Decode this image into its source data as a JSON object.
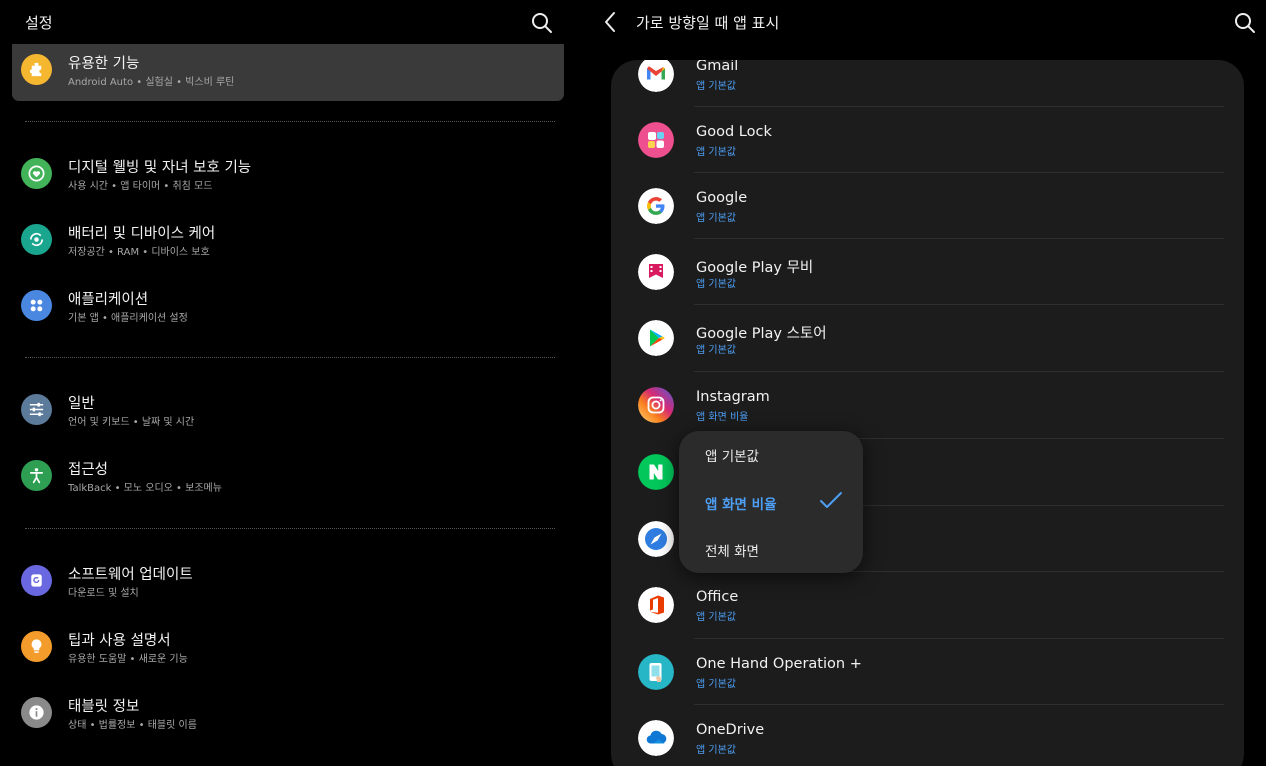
{
  "left": {
    "title": "설정",
    "items": [
      {
        "title": "유용한 기능",
        "sub": "Android Auto  •  실험실  •  빅스비 루틴",
        "icon": "puzzle-icon",
        "color": "#f5b630"
      },
      {
        "title": "디지털 웰빙 및 자녀 보호 기능",
        "sub": "사용 시간  •  앱 타이머  •  취침 모드",
        "icon": "heart-circle-icon",
        "color": "#43b35a"
      },
      {
        "title": "배터리 및 디바이스 케어",
        "sub": "저장공간  •  RAM  •  디바이스 보호",
        "icon": "device-care-icon",
        "color": "#1aa58f"
      },
      {
        "title": "애플리케이션",
        "sub": "기본 앱  •  애플리케이션 설정",
        "icon": "apps-grid-icon",
        "color": "#4a87e0"
      },
      {
        "title": "일반",
        "sub": "언어 및 키보드  •  날짜 및 시간",
        "icon": "sliders-icon",
        "color": "#5c7a9a"
      },
      {
        "title": "접근성",
        "sub": "TalkBack  •  모노 오디오  •  보조메뉴",
        "icon": "accessibility-icon",
        "color": "#2e9e52"
      },
      {
        "title": "소프트웨어 업데이트",
        "sub": "다운로드 및 설치",
        "icon": "update-icon",
        "color": "#6a68e0"
      },
      {
        "title": "팁과 사용 설명서",
        "sub": "유용한 도움말  •  새로운 기능",
        "icon": "lightbulb-icon",
        "color": "#f39c2b"
      },
      {
        "title": "태블릿 정보",
        "sub": "상태  •  법률정보  •  태블릿 이름",
        "icon": "info-icon",
        "color": "#8a8a8a"
      }
    ]
  },
  "right": {
    "title": "가로 방향일 때 앱 표시",
    "apps": [
      {
        "name": "Gmail",
        "setting": "앱 기본값",
        "icon": "gmail-icon"
      },
      {
        "name": "Good Lock",
        "setting": "앱 기본값",
        "icon": "good-lock-icon"
      },
      {
        "name": "Google",
        "setting": "앱 기본값",
        "icon": "google-icon"
      },
      {
        "name": "Google Play 무비",
        "setting": "앱 기본값",
        "icon": "play-movies-icon"
      },
      {
        "name": "Google Play 스토어",
        "setting": "앱 기본값",
        "icon": "play-store-icon"
      },
      {
        "name": "Instagram",
        "setting": "앱 화면 비율",
        "icon": "instagram-icon"
      },
      {
        "name": "",
        "setting": "",
        "icon": "naver-icon"
      },
      {
        "name": "",
        "setting": "",
        "icon": "internet-icon"
      },
      {
        "name": "Office",
        "setting": "앱 기본값",
        "icon": "office-icon"
      },
      {
        "name": "One Hand Operation +",
        "setting": "앱 기본값",
        "icon": "one-hand-icon"
      },
      {
        "name": "OneDrive",
        "setting": "앱 기본값",
        "icon": "onedrive-icon"
      }
    ]
  },
  "dropdown": {
    "options": [
      "앱 기본값",
      "앱 화면 비율",
      "전체 화면"
    ],
    "selected": "앱 화면 비율"
  },
  "colors": {
    "accent": "#4d9ff5",
    "card": "#1c1c1c",
    "selected_row": "#3a3a3a"
  }
}
